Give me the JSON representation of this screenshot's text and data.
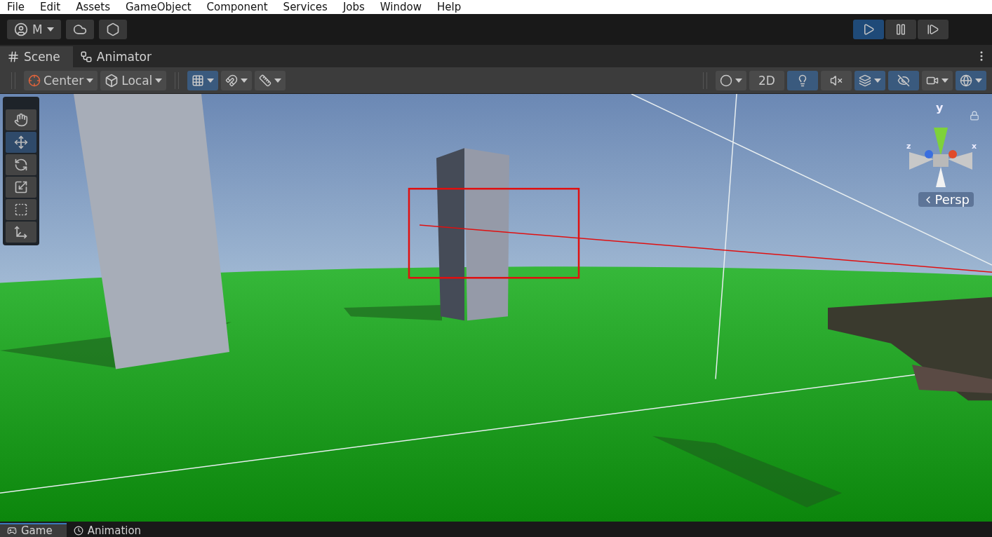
{
  "menu": [
    "File",
    "Edit",
    "Assets",
    "GameObject",
    "Component",
    "Services",
    "Jobs",
    "Window",
    "Help"
  ],
  "toolbar": {
    "account": "M",
    "buttons": [
      {
        "kind": "cloud"
      },
      {
        "kind": "collab"
      }
    ],
    "play_controls": [
      {
        "kind": "play",
        "selected": true
      },
      {
        "kind": "pause",
        "selected": false
      },
      {
        "kind": "step",
        "selected": false
      }
    ]
  },
  "tabs": [
    {
      "label": "Scene",
      "kind": "scene",
      "selected": true
    },
    {
      "label": "Animator",
      "kind": "animator",
      "selected": false
    }
  ],
  "scene_toolbar": {
    "pivot": "Center",
    "space": "Local",
    "snapping": [
      {
        "kind": "grid",
        "selected": true
      },
      {
        "kind": "snap",
        "selected": false
      },
      {
        "kind": "increment",
        "selected": false
      }
    ],
    "view_options": [
      {
        "kind": "shading",
        "selected": false
      },
      {
        "kind": "flat",
        "label": "2D",
        "selected": false
      },
      {
        "kind": "lighting",
        "selected": true
      },
      {
        "kind": "audio",
        "selected": false
      },
      {
        "kind": "effects",
        "selected": true
      },
      {
        "kind": "visibility",
        "selected": true
      },
      {
        "kind": "camera",
        "selected": false
      },
      {
        "kind": "gizmos",
        "selected": true
      }
    ]
  },
  "tools": [
    {
      "kind": "hand",
      "selected": false
    },
    {
      "kind": "move",
      "selected": true
    },
    {
      "kind": "rotate",
      "selected": false
    },
    {
      "kind": "scale",
      "selected": false
    },
    {
      "kind": "rect",
      "selected": false
    },
    {
      "kind": "transform",
      "selected": false
    }
  ],
  "gizmo": {
    "axes": [
      "y",
      "z",
      "x"
    ],
    "projection": "Persp"
  },
  "bottom_tabs": [
    {
      "label": "Game",
      "kind": "game",
      "selected": true
    },
    {
      "label": "Animation",
      "kind": "animation",
      "selected": false
    }
  ]
}
